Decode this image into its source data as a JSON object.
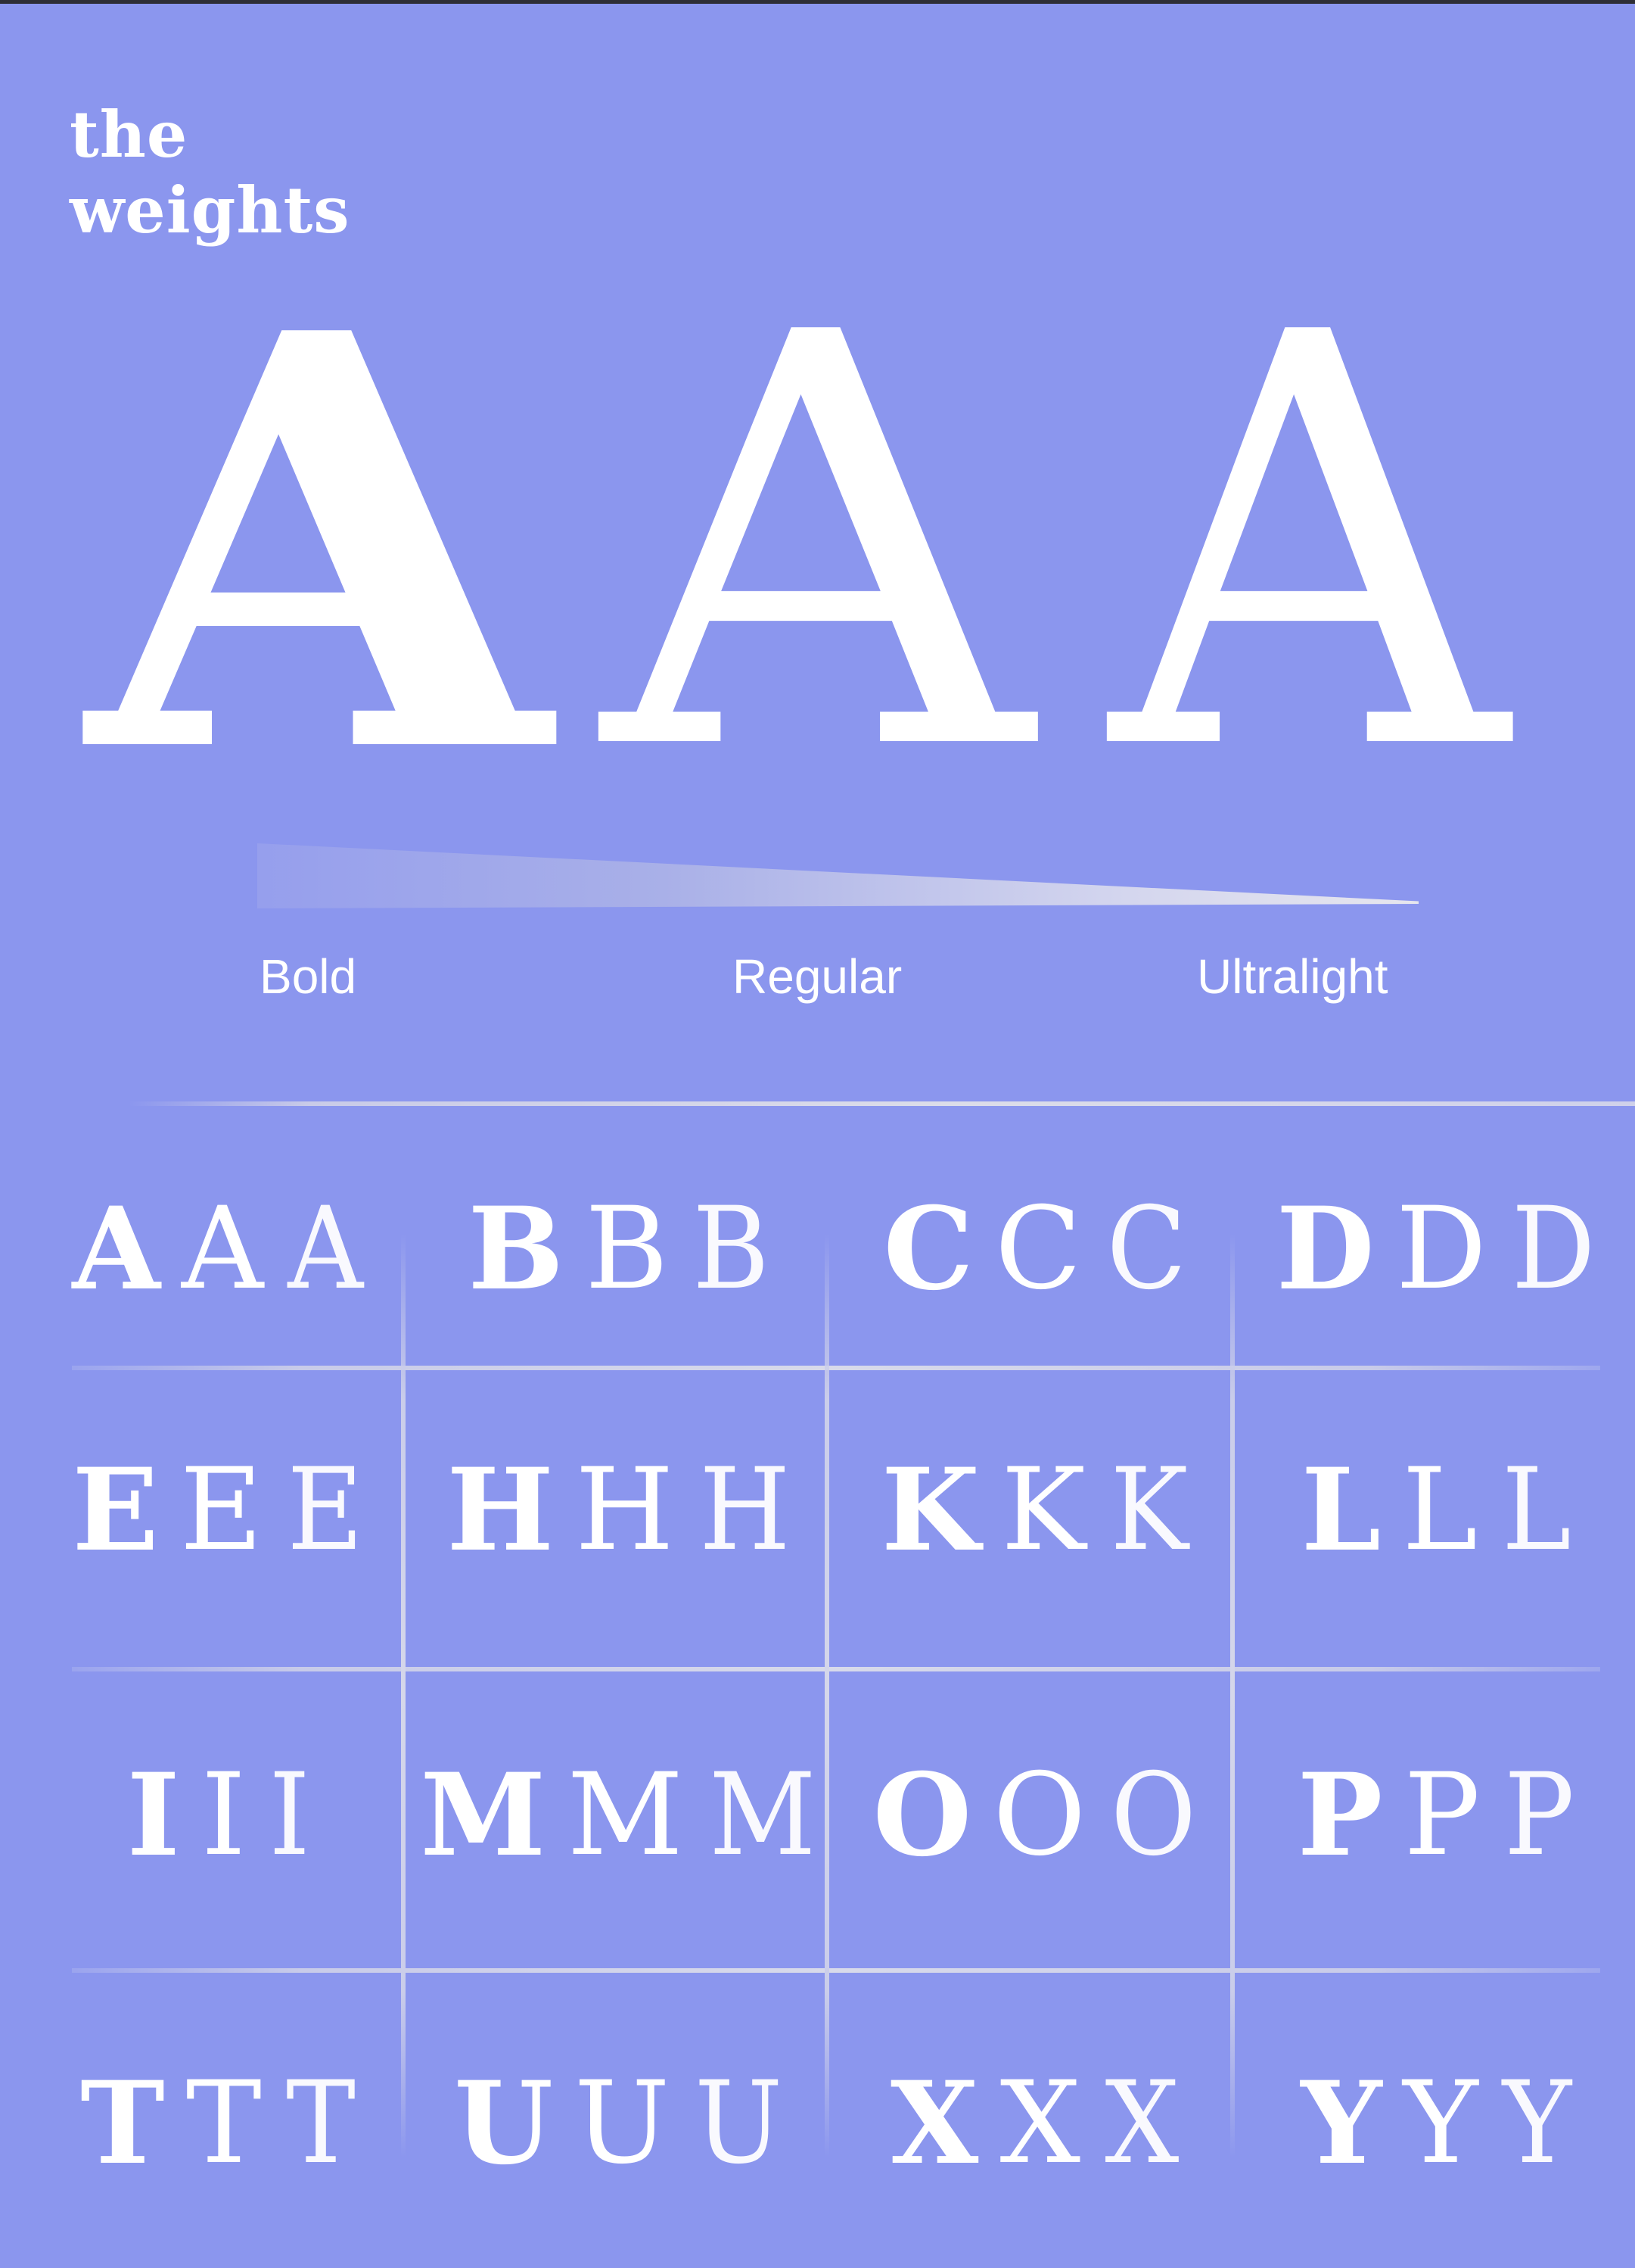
{
  "title": {
    "line1": "the",
    "line2": "weights"
  },
  "hero": {
    "glyph": "A"
  },
  "weights": {
    "bold": "Bold",
    "regular": "Regular",
    "ultralight": "Ultralight"
  },
  "grid": [
    [
      "A",
      "B",
      "C",
      "D"
    ],
    [
      "E",
      "H",
      "K",
      "L"
    ],
    [
      "I",
      "M",
      "O",
      "P"
    ],
    [
      "T",
      "U",
      "X",
      "Y"
    ]
  ],
  "colors": {
    "background": "#8b96ee",
    "text": "#ffffff",
    "rule": "#d5d7ea"
  }
}
